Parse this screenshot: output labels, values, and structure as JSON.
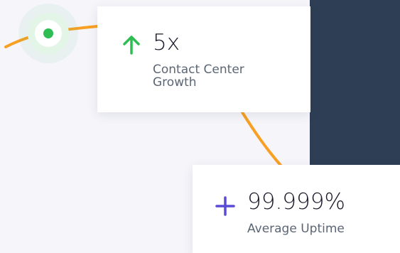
{
  "colors": {
    "background": "#f5f5fa",
    "dark_panel": "#2d3e55",
    "orange_line": "#f7a024",
    "green_line": "#35c35a",
    "green_arrow": "#2dbd52",
    "purple_plus": "#5a4bd6",
    "value_text": "#1a1a2b",
    "label_text": "#5b6675"
  },
  "stats": {
    "growth": {
      "icon": "arrow-up-icon",
      "value": "5x",
      "label": "Contact Center Growth"
    },
    "uptime": {
      "icon": "plus-icon",
      "value": "99.999%",
      "label": "Average Uptime"
    }
  }
}
